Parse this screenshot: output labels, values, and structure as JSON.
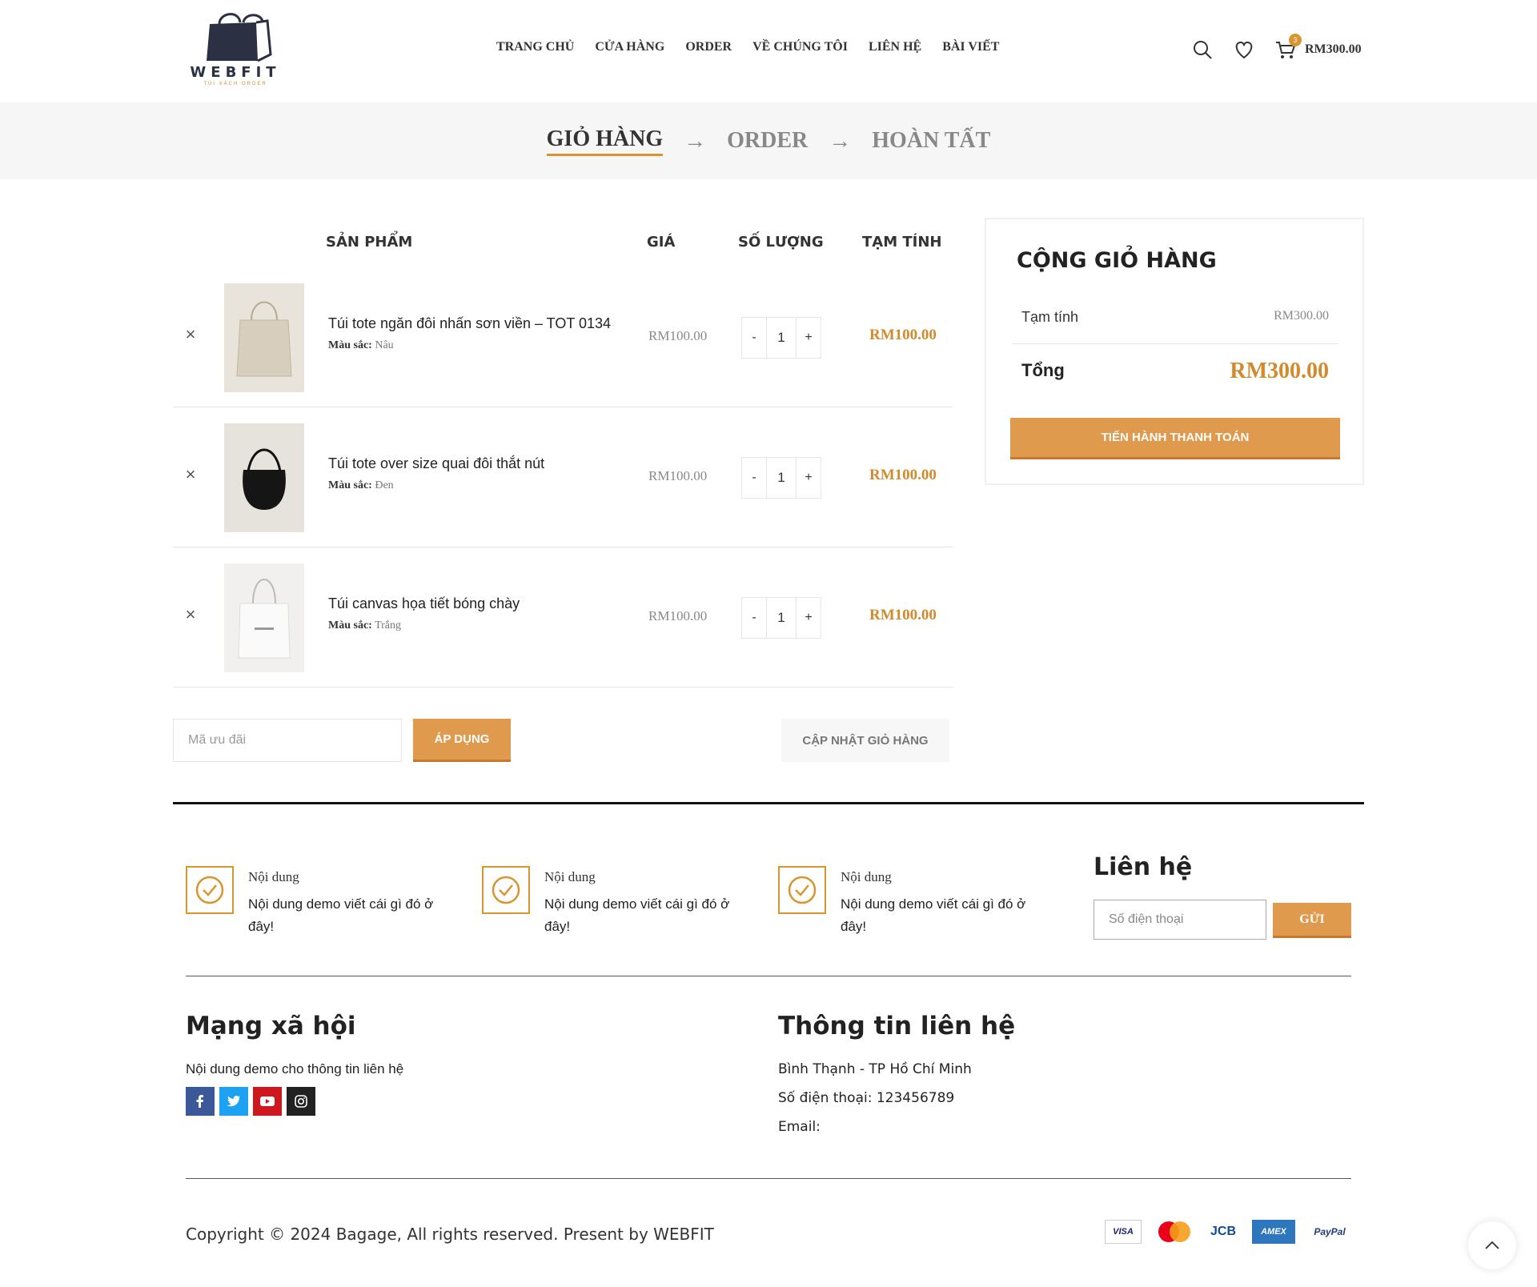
{
  "header": {
    "logo_text": "WEBFIT",
    "logo_subtitle": "TÚI XÁCH ORDER",
    "nav": [
      "TRANG CHỦ",
      "CỬA HÀNG",
      "ORDER",
      "VỀ CHÚNG TÔI",
      "LIÊN HỆ",
      "BÀI VIẾT"
    ],
    "cart_count": "3",
    "cart_total": "RM300.00"
  },
  "steps": {
    "cart": "GIỎ HÀNG",
    "order": "ORDER",
    "done": "HOÀN TẤT",
    "arrow": "→"
  },
  "cart": {
    "headers": {
      "product": "SẢN PHẨM",
      "price": "GIÁ",
      "qty": "SỐ LƯỢNG",
      "subtotal": "TẠM TÍNH"
    },
    "attr_label": "Màu sắc:",
    "items": [
      {
        "name": "Túi tote ngăn đôi nhấn sơn viền – TOT 0134",
        "color": "Nâu",
        "price": "RM100.00",
        "qty": "1",
        "subtotal": "RM100.00"
      },
      {
        "name": "Túi tote over size quai đôi thắt nút",
        "color": "Đen",
        "price": "RM100.00",
        "qty": "1",
        "subtotal": "RM100.00"
      },
      {
        "name": "Túi canvas họa tiết bóng chày",
        "color": "Trắng",
        "price": "RM100.00",
        "qty": "1",
        "subtotal": "RM100.00"
      }
    ],
    "coupon_placeholder": "Mã ưu đãi",
    "apply_label": "ÁP DỤNG",
    "update_label": "CẬP NHẬT GIỎ HÀNG"
  },
  "totals": {
    "title": "CỘNG GIỎ HÀNG",
    "subtotal_label": "Tạm tính",
    "subtotal_value": "RM300.00",
    "total_label": "Tổng",
    "total_value": "RM300.00",
    "checkout_label": "TIẾN HÀNH THANH TOÁN"
  },
  "footer": {
    "features": [
      {
        "title": "Nội dung",
        "text": "Nội dung demo viết cái gì đó ở đây!"
      },
      {
        "title": "Nội dung",
        "text": "Nội dung demo viết cái gì đó ở đây!"
      },
      {
        "title": "Nội dung",
        "text": "Nội dung demo viết cái gì đó ở đây!"
      }
    ],
    "contact_title": "Liên hệ",
    "phone_placeholder": "Số điện thoại",
    "send_label": "GỬI",
    "social_title": "Mạng xã hội",
    "social_text": "Nội dung demo cho thông tin liên hệ",
    "info_title": "Thông tin liên hệ",
    "address": "Bình Thạnh - TP Hồ Chí Minh",
    "phone": "Số điện thoại: 123456789",
    "email": "Email:",
    "copyright": "Copyright © 2024 Bagage, All rights reserved. Present by WEBFIT",
    "payments": [
      "VISA",
      "MasterCard",
      "JCB",
      "AMEX",
      "PayPal"
    ]
  },
  "colors": {
    "accent": "#e09a4d",
    "accent_dark": "#d28a2c",
    "text": "#222222"
  }
}
